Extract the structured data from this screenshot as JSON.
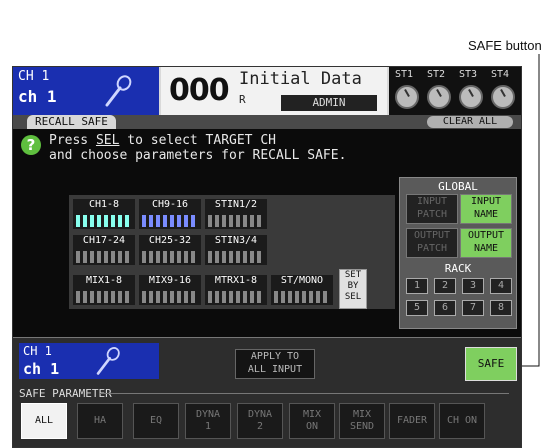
{
  "annotation": "SAFE button",
  "header": {
    "ch_num": "CH 1",
    "ch_name": "ch 1",
    "scene_number": "000",
    "scene_title": "Initial Data",
    "scene_r": "R",
    "user": "ADMIN",
    "st_labels": [
      "ST1",
      "ST2",
      "ST3",
      "ST4"
    ]
  },
  "tab": {
    "title": "RECALL SAFE",
    "clear_all": "CLEAR ALL"
  },
  "instruction": {
    "pre": "Press ",
    "sel": "SEL",
    "post": " to select TARGET CH",
    "line2": "and choose parameters for RECALL SAFE."
  },
  "channel_grid": {
    "ch1_8": "CH1-8",
    "ch9_16": "CH9-16",
    "stin12": "STIN1/2",
    "ch17_24": "CH17-24",
    "ch25_32": "CH25-32",
    "stin34": "STIN3/4",
    "mix1_8": "MIX1-8",
    "mix9_16": "MIX9-16",
    "mtrx1_8": "MTRX1-8",
    "st_mono": "ST/MONO",
    "set_by_sel": "SET\nBY\nSEL"
  },
  "global": {
    "title": "GLOBAL",
    "input_patch": "INPUT\nPATCH",
    "input_name": "INPUT\nNAME",
    "output_patch": "OUTPUT\nPATCH",
    "output_name": "OUTPUT\nNAME",
    "rack_title": "RACK",
    "rack": [
      "1",
      "2",
      "3",
      "4",
      "5",
      "6",
      "7",
      "8"
    ]
  },
  "bottom": {
    "ch_num": "CH 1",
    "ch_name": "ch 1",
    "apply": "APPLY TO\nALL INPUT",
    "safe": "SAFE",
    "safe_parameter": "SAFE PARAMETER",
    "params": [
      "ALL",
      "HA",
      "EQ",
      "DYNA\n1",
      "DYNA\n2",
      "MIX\nON",
      "MIX\nSEND",
      "FADER",
      "CH ON"
    ]
  },
  "colors": {
    "channel_blue": "#1a2fb0",
    "active_green": "#7fcf5f",
    "lcd_black": "#0b0b0b"
  }
}
